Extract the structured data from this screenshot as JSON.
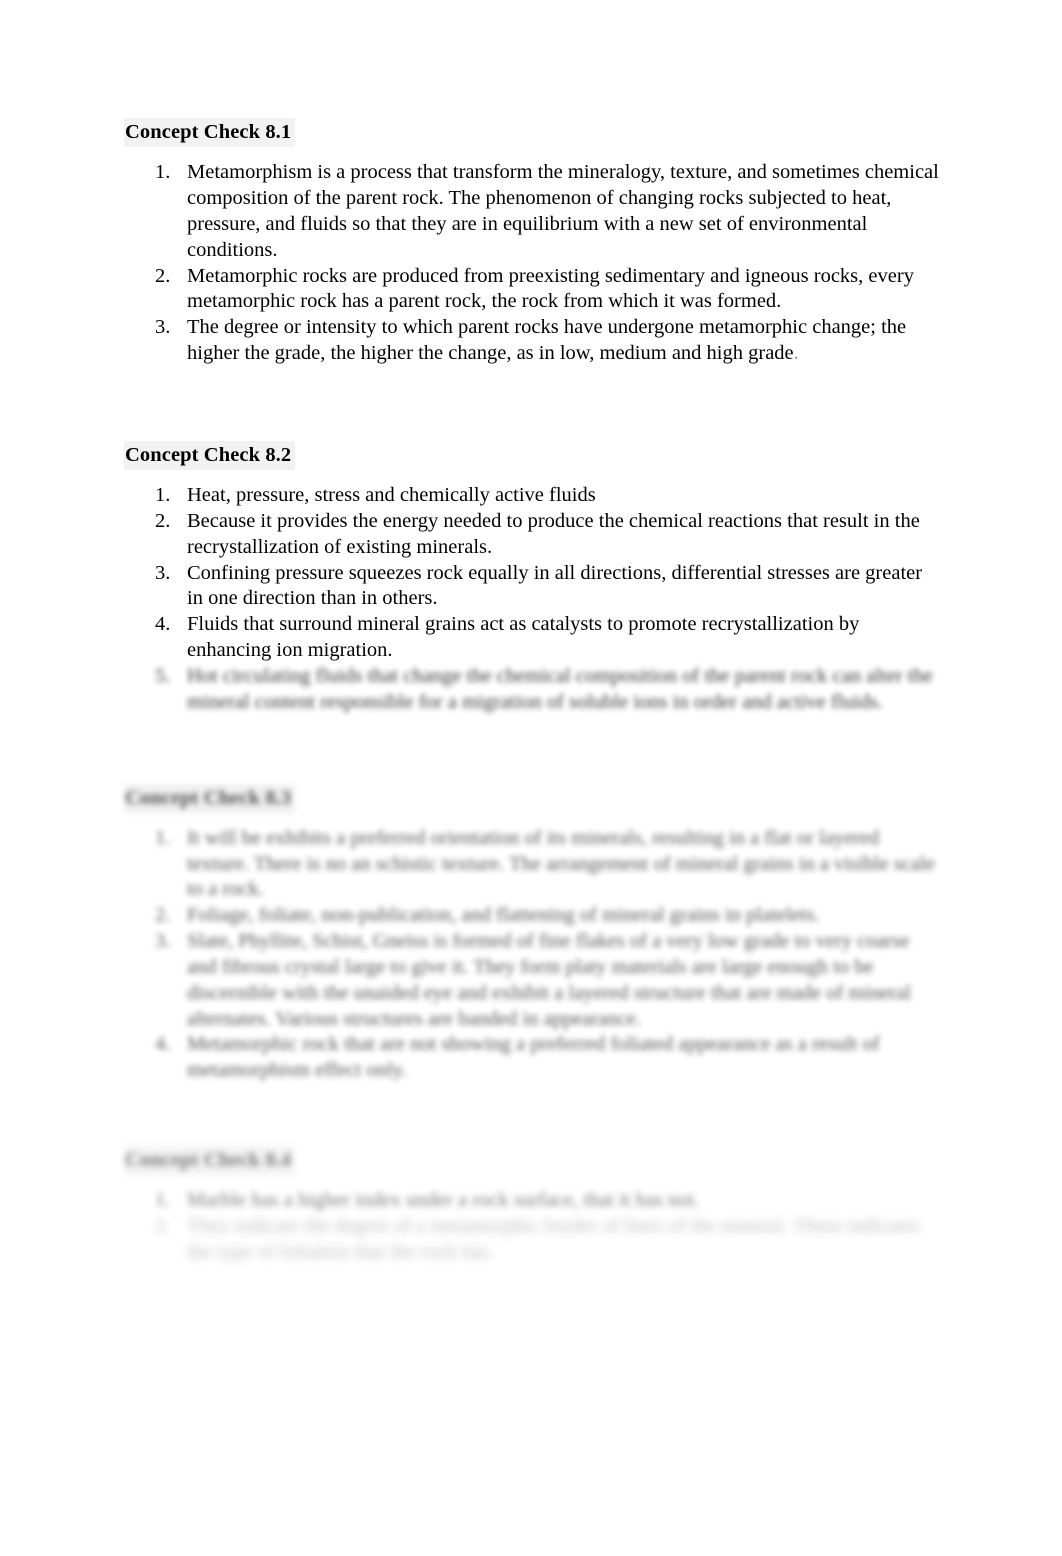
{
  "document": {
    "page_background": "#ffffff",
    "text_color": "#000000",
    "heading_highlight": "#f2f2f2"
  },
  "sections": [
    {
      "heading": "Concept Check 8.1",
      "legible": true,
      "items": [
        {
          "number": "1.",
          "text": "Metamorphism is a process that transform the mineralogy, texture, and sometimes chemical composition of the parent rock. The phenomenon of changing rocks subjected to heat, pressure, and fluids so that they are in equilibrium with a new set of environmental conditions."
        },
        {
          "number": "2.",
          "text": "Metamorphic rocks are produced from preexisting sedimentary and igneous rocks, every metamorphic rock has a parent rock, the rock from which it was formed."
        },
        {
          "number": "3.",
          "text": "The degree or intensity to which parent rocks have undergone metamorphic change; the higher the grade, the higher the change, as in low, medium and high grade",
          "trailing_stop": "."
        }
      ]
    },
    {
      "heading": "Concept Check 8.2",
      "legible": true,
      "items": [
        {
          "number": "1.",
          "text": "Heat, pressure, stress and chemically active fluids"
        },
        {
          "number": "2.",
          "text": "Because it provides the energy needed to produce the chemical reactions that result in the recrystallization of existing minerals."
        },
        {
          "number": "3.",
          "text": "Confining pressure squeezes rock equally in all directions, differential stresses are greater in one direction than in others."
        },
        {
          "number": "4.",
          "text": "Fluids that surround mineral grains act as catalysts to promote recrystallization by enhancing ion migration."
        },
        {
          "number": "5.",
          "legible": false,
          "text": "Hot circulating fluids that change the chemical composition of the parent rock can alter the mineral content responsible for a migration of soluble ions in order and active fluids."
        }
      ]
    },
    {
      "heading": "Concept Check 8.3",
      "legible": false,
      "items": [
        {
          "number": "1.",
          "legible": false,
          "text": "It will be exhibits a preferred orientation of its minerals, resulting in a flat or layered texture. There is no an schistic texture. The arrangement of mineral grains in a visible scale to a rock."
        },
        {
          "number": "2.",
          "legible": false,
          "text": "Foliage, foliate, non-publication, and flattening of mineral grains in platelets."
        },
        {
          "number": "3.",
          "legible": false,
          "text": "Slate, Phyllite, Schist, Gneiss is formed of fine flakes of a very low grade to very coarse and fibrous crystal large to give it. They form platy materials are large enough to be discernible with the unaided eye and exhibit a layered structure that are made of mineral alternates. Various structures are banded in appearance."
        },
        {
          "number": "4.",
          "legible": false,
          "text": "Metamorphic rock that are not showing a preferred foliated appearance as a result of metamorphism effect only."
        }
      ]
    },
    {
      "heading": "Concept Check 8.4",
      "legible": false,
      "items": [
        {
          "number": "1.",
          "legible": false,
          "text": "Marble has a higher index under a rock surface, that it has not."
        },
        {
          "number": "2.",
          "legible": false,
          "text": "They indicate the degree of a metamorphic border of lines of the mineral. These indicates the type of foliation that the rock has."
        }
      ]
    }
  ]
}
